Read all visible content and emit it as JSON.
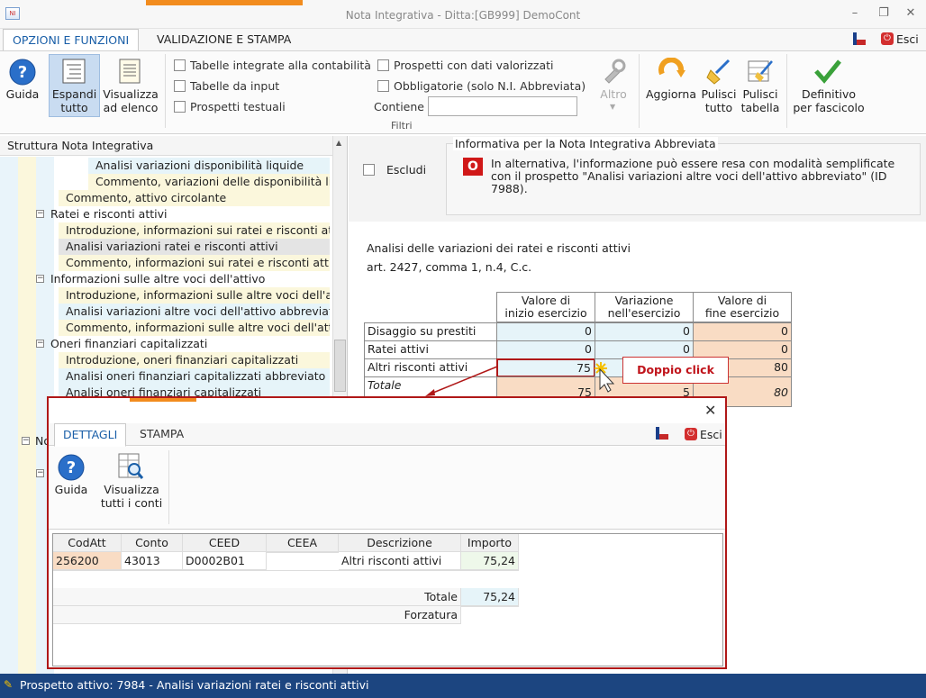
{
  "window": {
    "title": "Nota Integrativa - Ditta:[GB999] DemoCont",
    "app_icon": "app-icon"
  },
  "tabs": [
    {
      "label": "OPZIONI E FUNZIONI"
    },
    {
      "label": "VALIDAZIONE E STAMPA"
    }
  ],
  "exit_label": "Esci",
  "ribbon": {
    "guida": "Guida",
    "espandi_1": "Espandi",
    "espandi_2": "tutto",
    "visualizza_1": "Visualizza",
    "visualizza_2": "ad elenco",
    "checkboxes": [
      {
        "label": "Tabelle integrate alla contabilità"
      },
      {
        "label": "Tabelle da input"
      },
      {
        "label": "Prospetti testuali"
      },
      {
        "label": "Prospetti con dati valorizzati"
      },
      {
        "label": "Obbligatorie (solo N.I. Abbreviata)"
      }
    ],
    "contiene": "Contiene",
    "filtri": "Filtri",
    "altro": "Altro",
    "aggiorna": "Aggiorna",
    "pulisci_tutto_1": "Pulisci",
    "pulisci_tutto_2": "tutto",
    "pulisci_tabella_1": "Pulisci",
    "pulisci_tabella_2": "tabella",
    "definitivo_1": "Definitivo",
    "definitivo_2": "per fascicolo"
  },
  "tree": {
    "header": "Struttura Nota Integrativa",
    "items": [
      {
        "label": "Analisi variazioni disponibilità liquide"
      },
      {
        "label": "Commento, variazioni delle disponibilità liquide"
      },
      {
        "label": "Commento, attivo circolante"
      },
      {
        "label": "Ratei e risconti attivi"
      },
      {
        "label": "Introduzione, informazioni sui ratei e risconti attivi"
      },
      {
        "label": "Analisi variazioni ratei e risconti attivi"
      },
      {
        "label": "Commento, informazioni sui ratei e risconti attivi"
      },
      {
        "label": "Informazioni sulle altre voci dell'attivo"
      },
      {
        "label": "Introduzione, informazioni sulle altre voci dell'attivo"
      },
      {
        "label": "Analisi variazioni altre voci dell'attivo abbreviato"
      },
      {
        "label": "Commento, informazioni sulle altre voci dell'attivo"
      },
      {
        "label": "Oneri finanziari capitalizzati"
      },
      {
        "label": "Introduzione, oneri finanziari capitalizzati"
      },
      {
        "label": "Analisi oneri finanziari capitalizzati abbreviato"
      },
      {
        "label": "Analisi oneri finanziari capitalizzati"
      },
      {
        "label": "No"
      }
    ]
  },
  "info": {
    "title": "Informativa per la Nota Integrativa Abbreviata",
    "escludi": "Escludi",
    "badge": "O",
    "line1": "In alternativa, l'informazione può essere resa con modalità semplificate",
    "line2": "con il prospetto \"Analisi variazioni altre voci dell'attivo abbreviato\" (ID",
    "line3": "7988)."
  },
  "prospetto": {
    "title1": "Analisi delle variazioni dei ratei e risconti attivi",
    "title2": "art. 2427, comma 1, n.4, C.c.",
    "headers": [
      {
        "l1": "Valore di",
        "l2": "inizio esercizio"
      },
      {
        "l1": "Variazione",
        "l2": "nell'esercizio"
      },
      {
        "l1": "Valore di",
        "l2": "fine esercizio"
      }
    ],
    "rows": [
      {
        "label": "Disaggio su prestiti",
        "v1": "0",
        "v2": "0",
        "v3": "0"
      },
      {
        "label": "Ratei attivi",
        "v1": "0",
        "v2": "0",
        "v3": "0"
      },
      {
        "label": "Altri risconti attivi",
        "v1": "75",
        "v2": "",
        "v3": "80"
      },
      {
        "label": "Totale",
        "v1": "75",
        "v2": "5",
        "v3": "80"
      }
    ],
    "callout": "Doppio click"
  },
  "popup": {
    "tabs": [
      {
        "label": "DETTAGLI"
      },
      {
        "label": "STAMPA"
      }
    ],
    "exit": "Esci",
    "guida": "Guida",
    "visualizza_1": "Visualizza",
    "visualizza_2": "tutti i conti",
    "columns": [
      "CodAtt",
      "Conto",
      "CEED",
      "CEEA",
      "Descrizione",
      "Importo"
    ],
    "row": {
      "codatt": "256200",
      "conto": "43013",
      "ceed": "D0002B01",
      "ceea": "",
      "descr": "Altri risconti attivi",
      "importo": "75,24"
    },
    "totale_label": "Totale",
    "totale_value": "75,24",
    "forzatura_label": "Forzatura",
    "forzatura_value": ""
  },
  "status": "Prospetto attivo: 7984 - Analisi variazioni ratei e risconti attivi",
  "colors": {
    "accent": "#1a5fa8",
    "status_bar": "#1c4580",
    "highlight_red": "#b01818",
    "tab_orange": "#f28c1e"
  }
}
